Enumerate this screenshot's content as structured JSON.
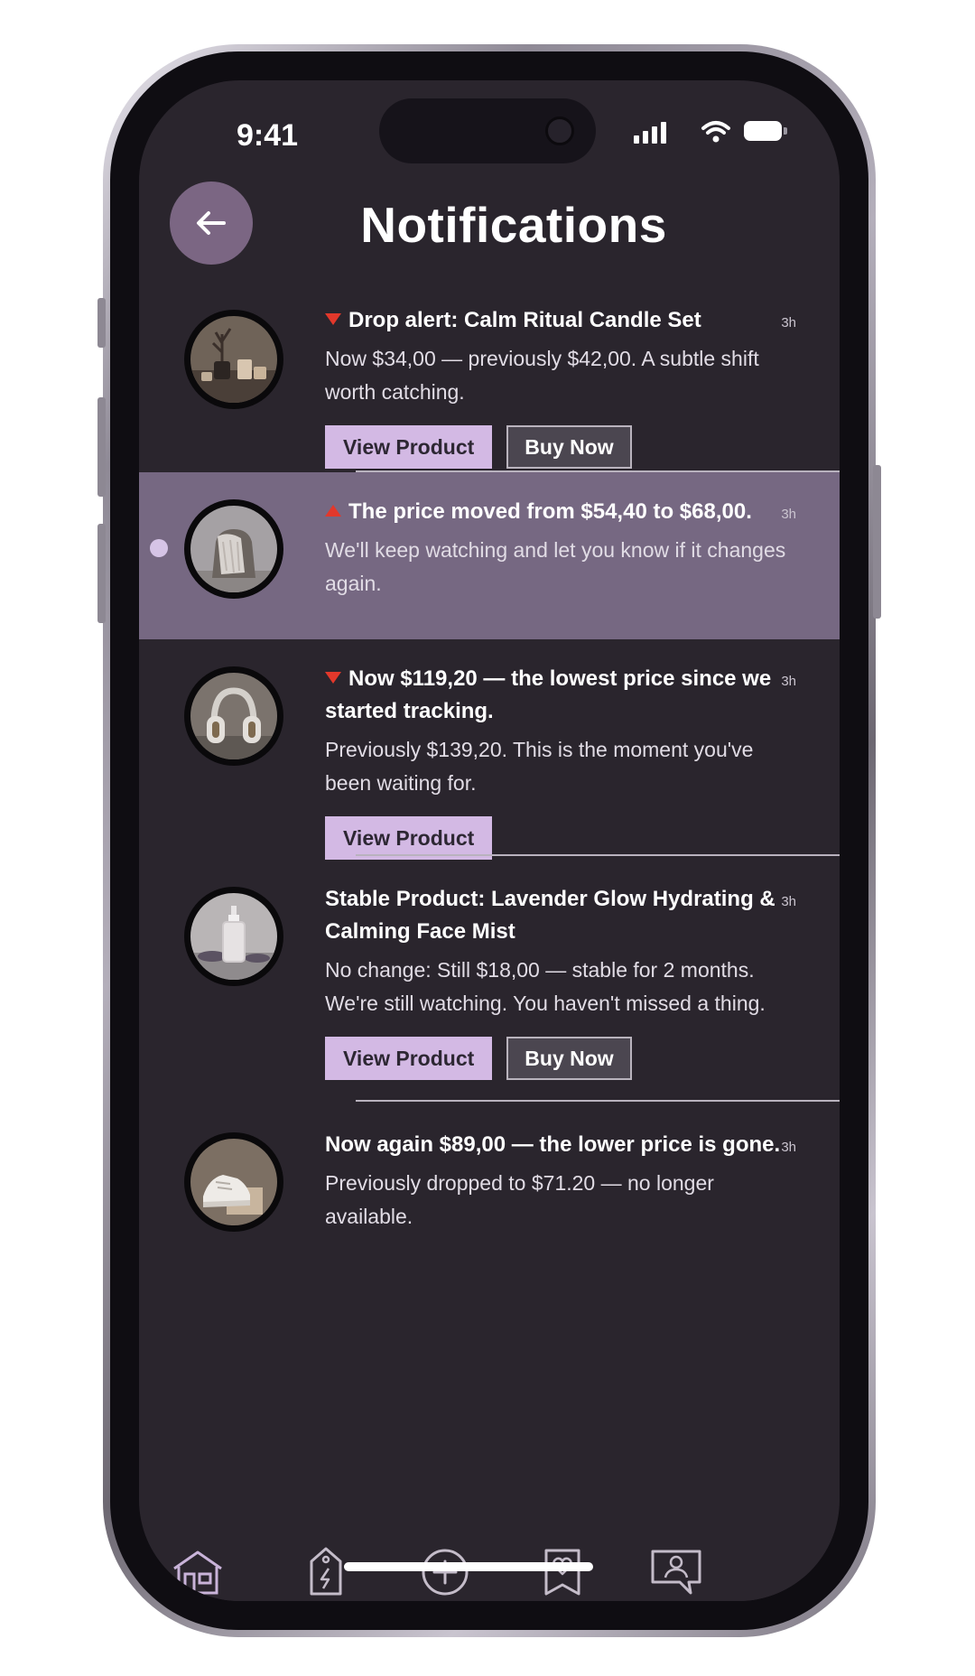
{
  "status_bar": {
    "time": "9:41"
  },
  "header": {
    "title": "Notifications",
    "back_icon": "arrow-left-icon"
  },
  "colors": {
    "background": "#2a252d",
    "highlight": "#766882",
    "accent": "#d3b9e4",
    "price_drop": "#e2382b",
    "unread_dot": "#d6c4e6"
  },
  "notifications": [
    {
      "title": "Drop alert: Calm Ritual Candle Set",
      "trend": "down",
      "time": "3h",
      "body": "Now $34,00 — previously $42,00. A subtle shift worth catching.",
      "actions": [
        "View Product",
        "Buy Now"
      ],
      "unread": false,
      "image": "candle-set-photo"
    },
    {
      "title": "The price moved from $54,40 to $68,00.",
      "trend": "up",
      "time": "3h",
      "body": "We'll keep watching and let you know if it changes again.",
      "actions": [],
      "unread": true,
      "image": "chair-blanket-photo"
    },
    {
      "title": "Now $119,20 — the lowest price since we started tracking.",
      "trend": "down",
      "time": "3h",
      "body": "Previously $139,20. This is the moment you've been waiting for.",
      "actions": [
        "View Product"
      ],
      "unread": false,
      "image": "headphones-photo"
    },
    {
      "title": "Stable Product: Lavender Glow Hydrating & Calming Face Mist",
      "trend": "none",
      "time": "3h",
      "body": "No change: Still $18,00 — stable for 2 months. We're still watching. You haven't missed a thing.",
      "actions": [
        "View Product",
        "Buy Now"
      ],
      "unread": false,
      "image": "face-mist-photo"
    },
    {
      "title": "Now again $89,00 — the lower price is gone.",
      "trend": "none",
      "time": "3h",
      "body": "Previously dropped to $71.20 — no longer available.",
      "actions": [],
      "unread": false,
      "image": "sneakers-photo"
    }
  ],
  "tab_bar": {
    "items": [
      {
        "icon": "home-icon",
        "active": true
      },
      {
        "icon": "price-tag-icon",
        "active": false
      },
      {
        "icon": "add-circle-icon",
        "active": false
      },
      {
        "icon": "wishlist-icon",
        "active": false
      },
      {
        "icon": "profile-message-icon",
        "active": false
      }
    ]
  }
}
